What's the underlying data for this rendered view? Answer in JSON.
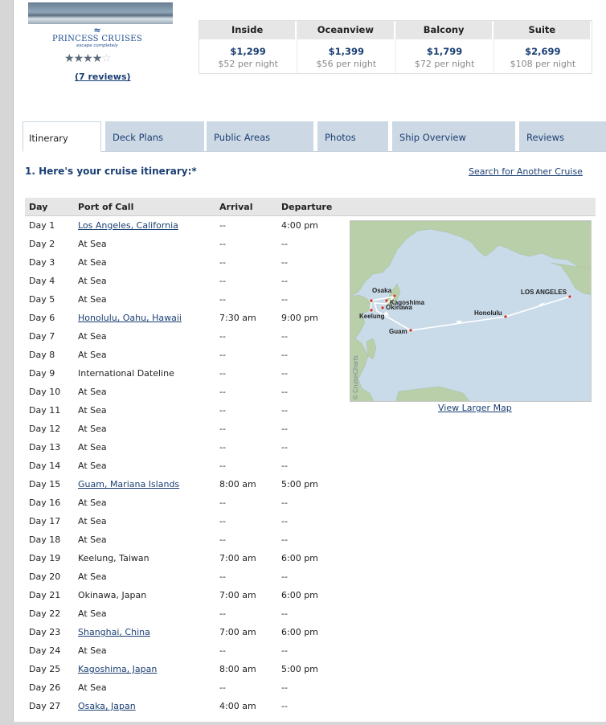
{
  "cruise_line": {
    "name": "PRINCESS CRUISES",
    "tagline": "escape completely",
    "rating_stars": 4,
    "rating_max": 5,
    "reviews_link": "(7 reviews)"
  },
  "prices": [
    {
      "category": "Inside",
      "price": "$1,299",
      "per_night": "$52 per night"
    },
    {
      "category": "Oceanview",
      "price": "$1,399",
      "per_night": "$56 per night"
    },
    {
      "category": "Balcony",
      "price": "$1,799",
      "per_night": "$72 per night"
    },
    {
      "category": "Suite",
      "price": "$2,699",
      "per_night": "$108 per night"
    }
  ],
  "tabs": [
    {
      "label": "Itinerary",
      "active": true
    },
    {
      "label": "Deck Plans",
      "active": false
    },
    {
      "label": "Public Areas",
      "active": false
    },
    {
      "label": "Photos",
      "active": false
    },
    {
      "label": "Ship Overview",
      "active": false
    },
    {
      "label": "Reviews",
      "active": false
    }
  ],
  "itinerary": {
    "title": "1. Here's your cruise itinerary:*",
    "search_link": "Search for Another Cruise",
    "columns": [
      "Day",
      "Port of Call",
      "Arrival",
      "Departure"
    ],
    "rows": [
      {
        "day": "Day 1",
        "port": "Los Angeles, California",
        "link": true,
        "arrival": "--",
        "departure": "4:00 pm"
      },
      {
        "day": "Day 2",
        "port": "At Sea",
        "link": false,
        "arrival": "--",
        "departure": "--"
      },
      {
        "day": "Day 3",
        "port": "At Sea",
        "link": false,
        "arrival": "--",
        "departure": "--"
      },
      {
        "day": "Day 4",
        "port": "At Sea",
        "link": false,
        "arrival": "--",
        "departure": "--"
      },
      {
        "day": "Day 5",
        "port": "At Sea",
        "link": false,
        "arrival": "--",
        "departure": "--"
      },
      {
        "day": "Day 6",
        "port": "Honolulu, Oahu, Hawaii",
        "link": true,
        "arrival": "7:30 am",
        "departure": "9:00 pm"
      },
      {
        "day": "Day 7",
        "port": "At Sea",
        "link": false,
        "arrival": "--",
        "departure": "--"
      },
      {
        "day": "Day 8",
        "port": "At Sea",
        "link": false,
        "arrival": "--",
        "departure": "--"
      },
      {
        "day": "Day 9",
        "port": "International Dateline",
        "link": false,
        "arrival": "--",
        "departure": "--"
      },
      {
        "day": "Day 10",
        "port": "At Sea",
        "link": false,
        "arrival": "--",
        "departure": "--"
      },
      {
        "day": "Day 11",
        "port": "At Sea",
        "link": false,
        "arrival": "--",
        "departure": "--"
      },
      {
        "day": "Day 12",
        "port": "At Sea",
        "link": false,
        "arrival": "--",
        "departure": "--"
      },
      {
        "day": "Day 13",
        "port": "At Sea",
        "link": false,
        "arrival": "--",
        "departure": "--"
      },
      {
        "day": "Day 14",
        "port": "At Sea",
        "link": false,
        "arrival": "--",
        "departure": "--"
      },
      {
        "day": "Day 15",
        "port": "Guam, Mariana Islands",
        "link": true,
        "arrival": "8:00 am",
        "departure": "5:00 pm"
      },
      {
        "day": "Day 16",
        "port": "At Sea",
        "link": false,
        "arrival": "--",
        "departure": "--"
      },
      {
        "day": "Day 17",
        "port": "At Sea",
        "link": false,
        "arrival": "--",
        "departure": "--"
      },
      {
        "day": "Day 18",
        "port": "At Sea",
        "link": false,
        "arrival": "--",
        "departure": "--"
      },
      {
        "day": "Day 19",
        "port": "Keelung, Taiwan",
        "link": false,
        "arrival": "7:00 am",
        "departure": "6:00 pm"
      },
      {
        "day": "Day 20",
        "port": "At Sea",
        "link": false,
        "arrival": "--",
        "departure": "--"
      },
      {
        "day": "Day 21",
        "port": "Okinawa, Japan",
        "link": false,
        "arrival": "7:00 am",
        "departure": "6:00 pm"
      },
      {
        "day": "Day 22",
        "port": "At Sea",
        "link": false,
        "arrival": "--",
        "departure": "--"
      },
      {
        "day": "Day 23",
        "port": "Shanghai, China",
        "link": true,
        "arrival": "7:00 am",
        "departure": "6:00 pm"
      },
      {
        "day": "Day 24",
        "port": "At Sea",
        "link": false,
        "arrival": "--",
        "departure": "--"
      },
      {
        "day": "Day 25",
        "port": "Kagoshima, Japan",
        "link": true,
        "arrival": "8:00 am",
        "departure": "5:00 pm"
      },
      {
        "day": "Day 26",
        "port": "At Sea",
        "link": false,
        "arrival": "--",
        "departure": "--"
      },
      {
        "day": "Day 27",
        "port": "Osaka, Japan",
        "link": true,
        "arrival": "4:00 am",
        "departure": "--"
      }
    ]
  },
  "map": {
    "labels": {
      "los_angeles": "LOS ANGELES",
      "honolulu": "Honolulu",
      "guam": "Guam",
      "keelung": "Keelung",
      "okinawa": "Okinawa",
      "kagoshima": "Kagoshima",
      "osaka": "Osaka"
    },
    "credit": "© CruiseCharts",
    "larger_map_link": "View Larger Map",
    "colors": {
      "ocean": "#c9dbe9",
      "land": "#b9cfa9",
      "route": "#ffffff",
      "port": "#c0392b"
    }
  }
}
